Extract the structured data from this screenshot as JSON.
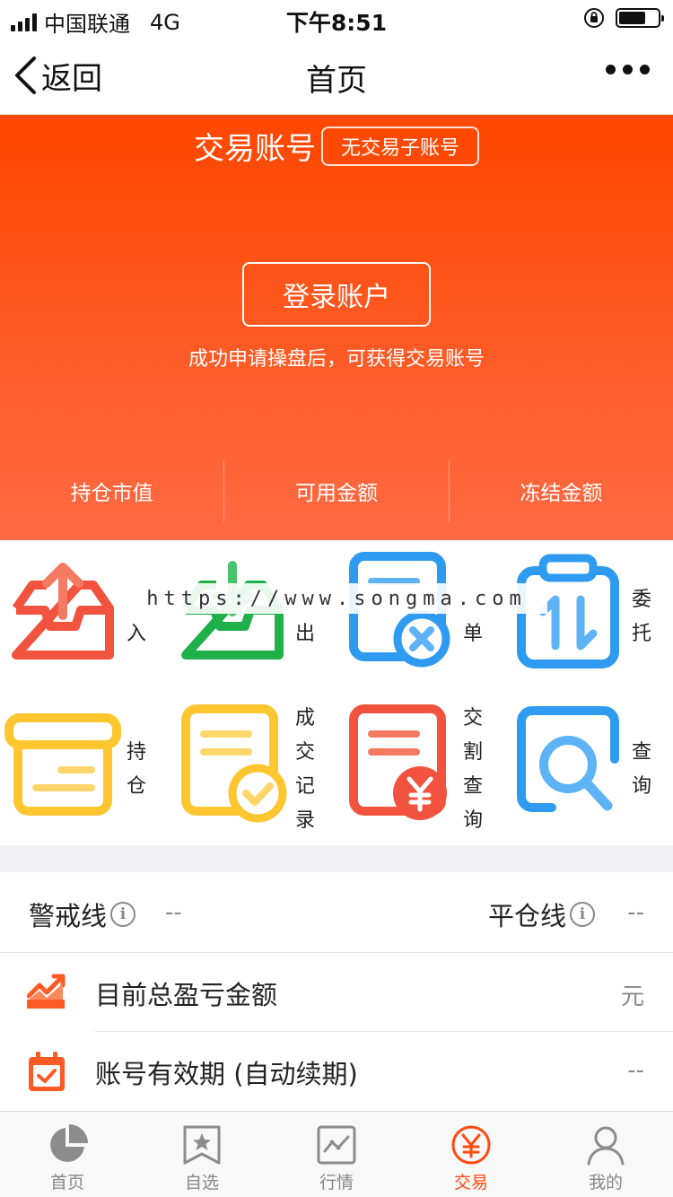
{
  "status_bar": {
    "carrier": "中国联通",
    "network": "4G",
    "time": "下午8:51"
  },
  "nav": {
    "back_label": "返回",
    "title": "首页"
  },
  "hero": {
    "title": "交易账号",
    "sub_badge": "无交易子账号",
    "login_button": "登录账户",
    "hint": "成功申请操盘后，可获得交易账号",
    "stats": [
      "持仓市值",
      "可用金额",
      "冻结金额"
    ]
  },
  "watermark": "https://www.songma.com",
  "grid": {
    "items": [
      {
        "label": "入"
      },
      {
        "label": "出"
      },
      {
        "label": "单"
      },
      {
        "label": "委托"
      },
      {
        "label": "持仓"
      },
      {
        "label": "成交记录"
      },
      {
        "label": "交割查询"
      },
      {
        "label": "查询"
      }
    ]
  },
  "risk": {
    "warning_label": "警戒线",
    "warning_value": "--",
    "close_label": "平仓线",
    "close_value": "--"
  },
  "rows": [
    {
      "label": "目前总盈亏金额",
      "value": "元",
      "icon": "trend-icon"
    },
    {
      "label": "账号有效期 (自动续期)",
      "value": "--",
      "icon": "calendar-check-icon"
    }
  ],
  "tabs": [
    {
      "label": "首页",
      "icon": "pie-chart-icon"
    },
    {
      "label": "自选",
      "icon": "bookmark-star-icon"
    },
    {
      "label": "行情",
      "icon": "market-line-icon"
    },
    {
      "label": "交易",
      "icon": "yen-circle-icon"
    },
    {
      "label": "我的",
      "icon": "user-icon"
    }
  ],
  "colors": {
    "accent": "#ff4a10",
    "hero_top": "#ff4700",
    "hero_bottom": "#ff6a44"
  }
}
